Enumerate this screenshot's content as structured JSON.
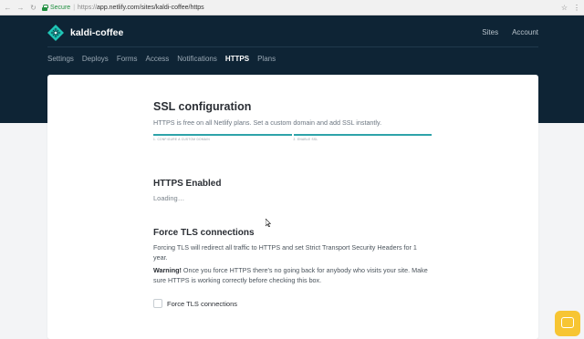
{
  "browser": {
    "back_icon": "back-arrow-icon",
    "forward_icon": "forward-arrow-icon",
    "reload_icon": "reload-icon",
    "secure_label": "Secure",
    "url_scheme": "https://",
    "url_rest": "app.netlify.com/sites/kaldi-coffee/https",
    "star_icon": "star-icon",
    "menu_icon": "kebab-menu-icon"
  },
  "header": {
    "site_name": "kaldi-coffee",
    "top_links": [
      "Sites",
      "Account"
    ],
    "tabs": [
      "Settings",
      "Deploys",
      "Forms",
      "Access",
      "Notifications",
      "HTTPS",
      "Plans"
    ],
    "active_tab": "HTTPS",
    "background_color": "#0e2435"
  },
  "main": {
    "title": "SSL configuration",
    "subtitle": "HTTPS is free on all Netlify plans. Set a custom domain and add SSL instantly.",
    "steps": [
      "1. CONFIGURE A CUSTOM DOMAIN",
      "2. ENABLE SSL"
    ],
    "https_section": {
      "title": "HTTPS Enabled",
      "status": "Loading…"
    },
    "tls_section": {
      "title": "Force TLS connections",
      "description": "Forcing TLS will redirect all traffic to HTTPS and set Strict Transport Security Headers for 1 year.",
      "warning_label": "Warning!",
      "warning_text": "Once you force HTTPS there's no going back for anybody who visits your site. Make sure HTTPS is working correctly before checking this box.",
      "checkbox_label": "Force TLS connections",
      "checked": false
    }
  },
  "accent_color": "#2ea3a9",
  "chat_widget_color": "#f7c533"
}
